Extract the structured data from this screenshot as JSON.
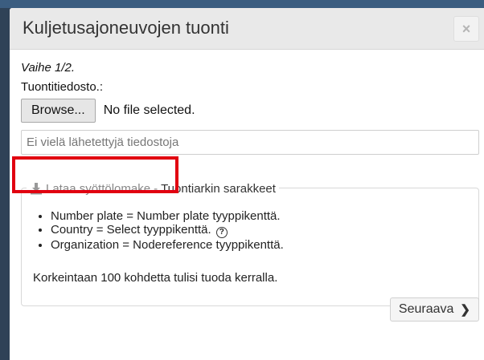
{
  "dialog": {
    "title": "Kuljetusajoneuvojen tuonti",
    "close_label": "×",
    "step": "Vaihe 1/2.",
    "file_label": "Tuontitiedosto.:",
    "browse_label": "Browse...",
    "file_status": "No file selected.",
    "uploads_placeholder": "Ei vielä lähetettyjä tiedostoja",
    "template": {
      "download_label": "Lataa syöttölomake",
      "separator": "-",
      "legend": "Tuontiarkin sarakkeet",
      "columns": [
        "Number plate = Number plate tyyppikenttä.",
        "Country = Select tyyppikenttä.",
        "Organization = Nodereference tyyppikenttä."
      ],
      "help_glyph": "?",
      "limit_note": "Korkeintaan 100 kohdetta tulisi tuoda kerralla."
    },
    "next_label": "Seuraava",
    "next_glyph": "❯"
  },
  "colors": {
    "highlight": "#e10010",
    "header_bg": "#e9e9e9",
    "backdrop": "#2f4257"
  }
}
